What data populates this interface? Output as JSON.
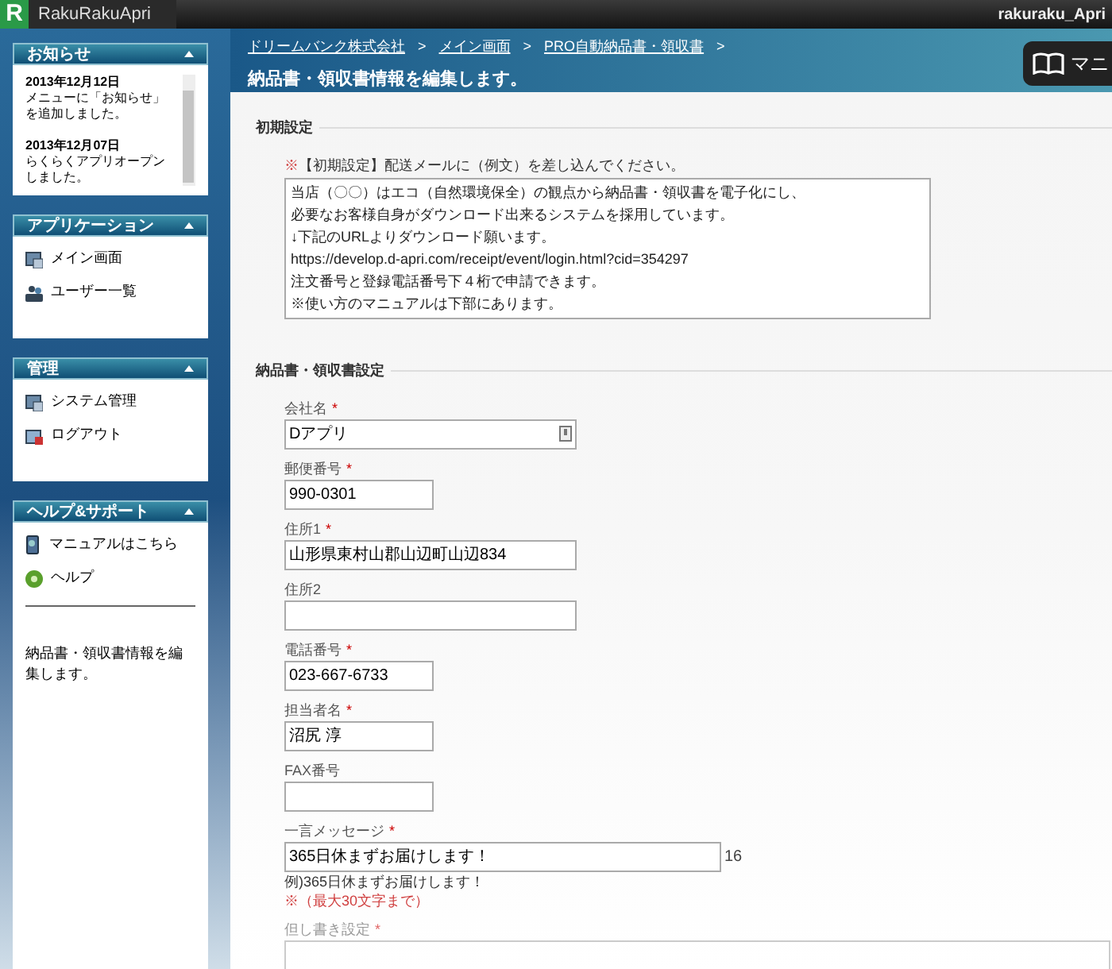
{
  "topbar": {
    "brand_letter": "R",
    "brand": "RakuRakuApri",
    "user": "rakuraku_Apri"
  },
  "sidebar": {
    "panels": [
      {
        "kind": "news",
        "title": "お知らせ",
        "expanded": true,
        "news": [
          {
            "date": "2013年12月12日",
            "text": "メニューに「お知らせ」を追加しました。"
          },
          {
            "date": "2013年12月07日",
            "text": "らくらくアプリオープンしました。"
          }
        ]
      },
      {
        "kind": "menu",
        "title": "アプリケーション",
        "expanded": true,
        "items": [
          {
            "label": "メイン画面",
            "kind": "window"
          },
          {
            "label": "ユーザー一覧",
            "kind": "users"
          }
        ]
      },
      {
        "kind": "menu",
        "title": "管理",
        "expanded": true,
        "items": [
          {
            "label": "システム管理",
            "kind": "window"
          },
          {
            "label": "ログアウト",
            "kind": "logout"
          }
        ]
      },
      {
        "kind": "help",
        "title": "ヘルプ&サポート",
        "expanded": true,
        "items": [
          {
            "label": "マニュアルはこちら",
            "kind": "manual"
          },
          {
            "label": "ヘルプ",
            "kind": "help"
          }
        ],
        "description": "納品書・領収書情報を編集します。"
      }
    ]
  },
  "header": {
    "breadcrumbs": [
      "ドリームバンク株式会社",
      "メイン画面",
      "PRO自動納品書・領収書"
    ],
    "separator": ">",
    "title": "納品書・領収書情報を編集します。",
    "manual_button": "マニ"
  },
  "sections": [
    {
      "kind": "textarea",
      "title": "初期設定",
      "note_mark": "※",
      "note": "【初期設定】配送メールに（例文）を差し込んでください。",
      "lines": [
        "当店（〇〇）はエコ（自然環境保全）の観点から納品書・領収書を電子化にし、",
        "必要なお客様自身がダウンロード出来るシステムを採用しています。",
        "↓下記のURLよりダウンロード願います。",
        "https://develop.d-apri.com/receipt/event/login.html?cid=354297",
        "注文番号と登録電話番号下４桁で申請できます。",
        "※使い方のマニュアルは下部にあります。"
      ]
    },
    {
      "kind": "fields",
      "title": "納品書・領収書設定",
      "fields": [
        {
          "label": "会社名",
          "mark": "*",
          "value": "Dアプリ",
          "kind": "picker"
        },
        {
          "label": "郵便番号",
          "mark": "*",
          "value": "990-0301",
          "kind": "narrow"
        },
        {
          "label": "住所1",
          "mark": "*",
          "value": "山形県東村山郡山辺町山辺834",
          "kind": "wide"
        },
        {
          "label": "住所2",
          "kind": "wide"
        },
        {
          "label": "電話番号",
          "mark": "*",
          "value": "023-667-6733",
          "kind": "narrow"
        },
        {
          "label": "担当者名",
          "mark": "*",
          "value": "沼尻 淳",
          "kind": "narrow"
        },
        {
          "label": "FAX番号",
          "kind": "narrow"
        },
        {
          "label": "一言メッセージ",
          "mark": "*",
          "value": "365日休まずお届けします！",
          "kind": "long",
          "counter": "16",
          "example": "例)365日休まずお届けします！",
          "limit": "※（最大30文字まで）"
        },
        {
          "label": "但し書き設定",
          "mark": "*",
          "kind": "faded"
        }
      ]
    }
  ]
}
